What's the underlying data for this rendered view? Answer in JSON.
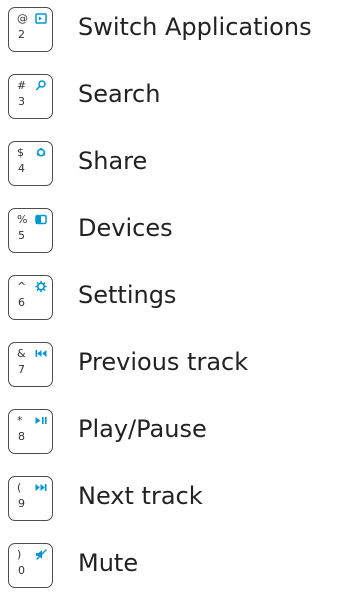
{
  "accent_color": "#0098d4",
  "keys": [
    {
      "symbol": "@",
      "number": "2",
      "icon": "switch-apps-icon",
      "label": "Switch Applications"
    },
    {
      "symbol": "#",
      "number": "3",
      "icon": "search-icon",
      "label": "Search"
    },
    {
      "symbol": "$",
      "number": "4",
      "icon": "share-icon",
      "label": "Share"
    },
    {
      "symbol": "%",
      "number": "5",
      "icon": "devices-icon",
      "label": "Devices"
    },
    {
      "symbol": "^",
      "number": "6",
      "icon": "settings-icon",
      "label": "Settings"
    },
    {
      "symbol": "&",
      "number": "7",
      "icon": "previous-track-icon",
      "label": "Previous track"
    },
    {
      "symbol": "*",
      "number": "8",
      "icon": "play-pause-icon",
      "label": "Play/Pause"
    },
    {
      "symbol": "(",
      "number": "9",
      "icon": "next-track-icon",
      "label": "Next track"
    },
    {
      "symbol": ")",
      "number": "0",
      "icon": "mute-icon",
      "label": "Mute"
    }
  ]
}
